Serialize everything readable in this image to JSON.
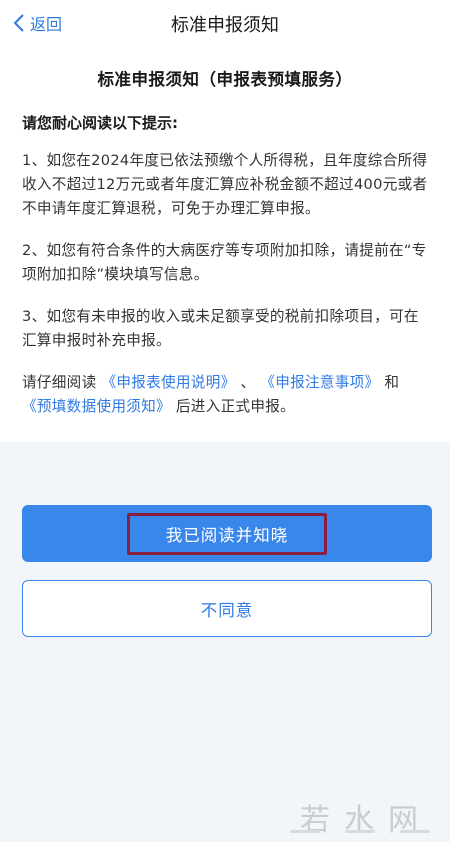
{
  "nav": {
    "back_label": "返回",
    "title": "标准申报须知"
  },
  "doc": {
    "title": "标准申报须知（申报表预填服务）",
    "tips_heading": "请您耐心阅读以下提示:",
    "item1": "1、如您在2024年度已依法预缴个人所得税，且年度综合所得收入不超过12万元或者年度汇算应补税金额不超过400元或者不申请年度汇算退税，可免于办理汇算申报。",
    "item2": "2、如您有符合条件的大病医疗等专项附加扣除，请提前在“专项附加扣除”模块填写信息。",
    "item3": "3、如您有未申报的收入或未足额享受的税前扣除项目，可在汇算申报时补充申报。",
    "final_prefix": "请仔细阅读",
    "link1": "《申报表使用说明》",
    "sep1": "、",
    "link2": "《申报注意事项》",
    "and": "和",
    "link3": "《预填数据使用须知》",
    "final_suffix": "后进入正式申报。"
  },
  "buttons": {
    "agree": "我已阅读并知晓",
    "disagree": "不同意"
  },
  "watermark": "若水网",
  "colors": {
    "accent": "#3a87ec",
    "link": "#2f7ae5",
    "highlight_box": "#8b1f3f"
  }
}
